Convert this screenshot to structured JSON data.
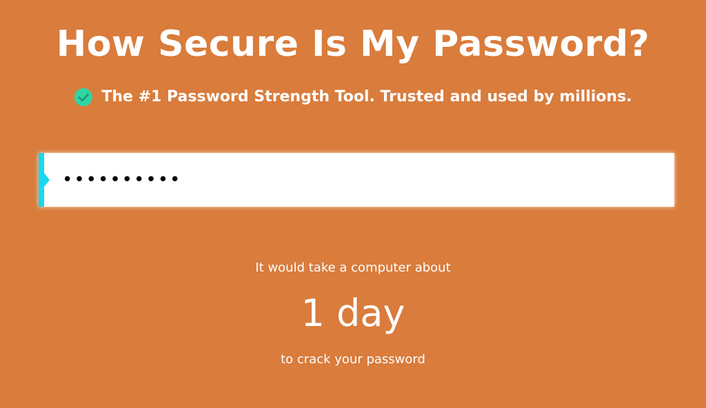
{
  "page": {
    "title": "How Secure Is My Password?",
    "tagline": "The #1 Password Strength Tool. Trusted and used by millions.",
    "tagline_icon": "check-circle-icon"
  },
  "password_field": {
    "value": "0123456789",
    "masked": true
  },
  "result": {
    "intro": "It would take a computer about",
    "time": "1 day",
    "outro": "to crack your password"
  },
  "colors": {
    "background": "#d97c3c",
    "accent": "#19d8f0",
    "check_icon": "#2fd6a4",
    "text": "#ffffff"
  }
}
